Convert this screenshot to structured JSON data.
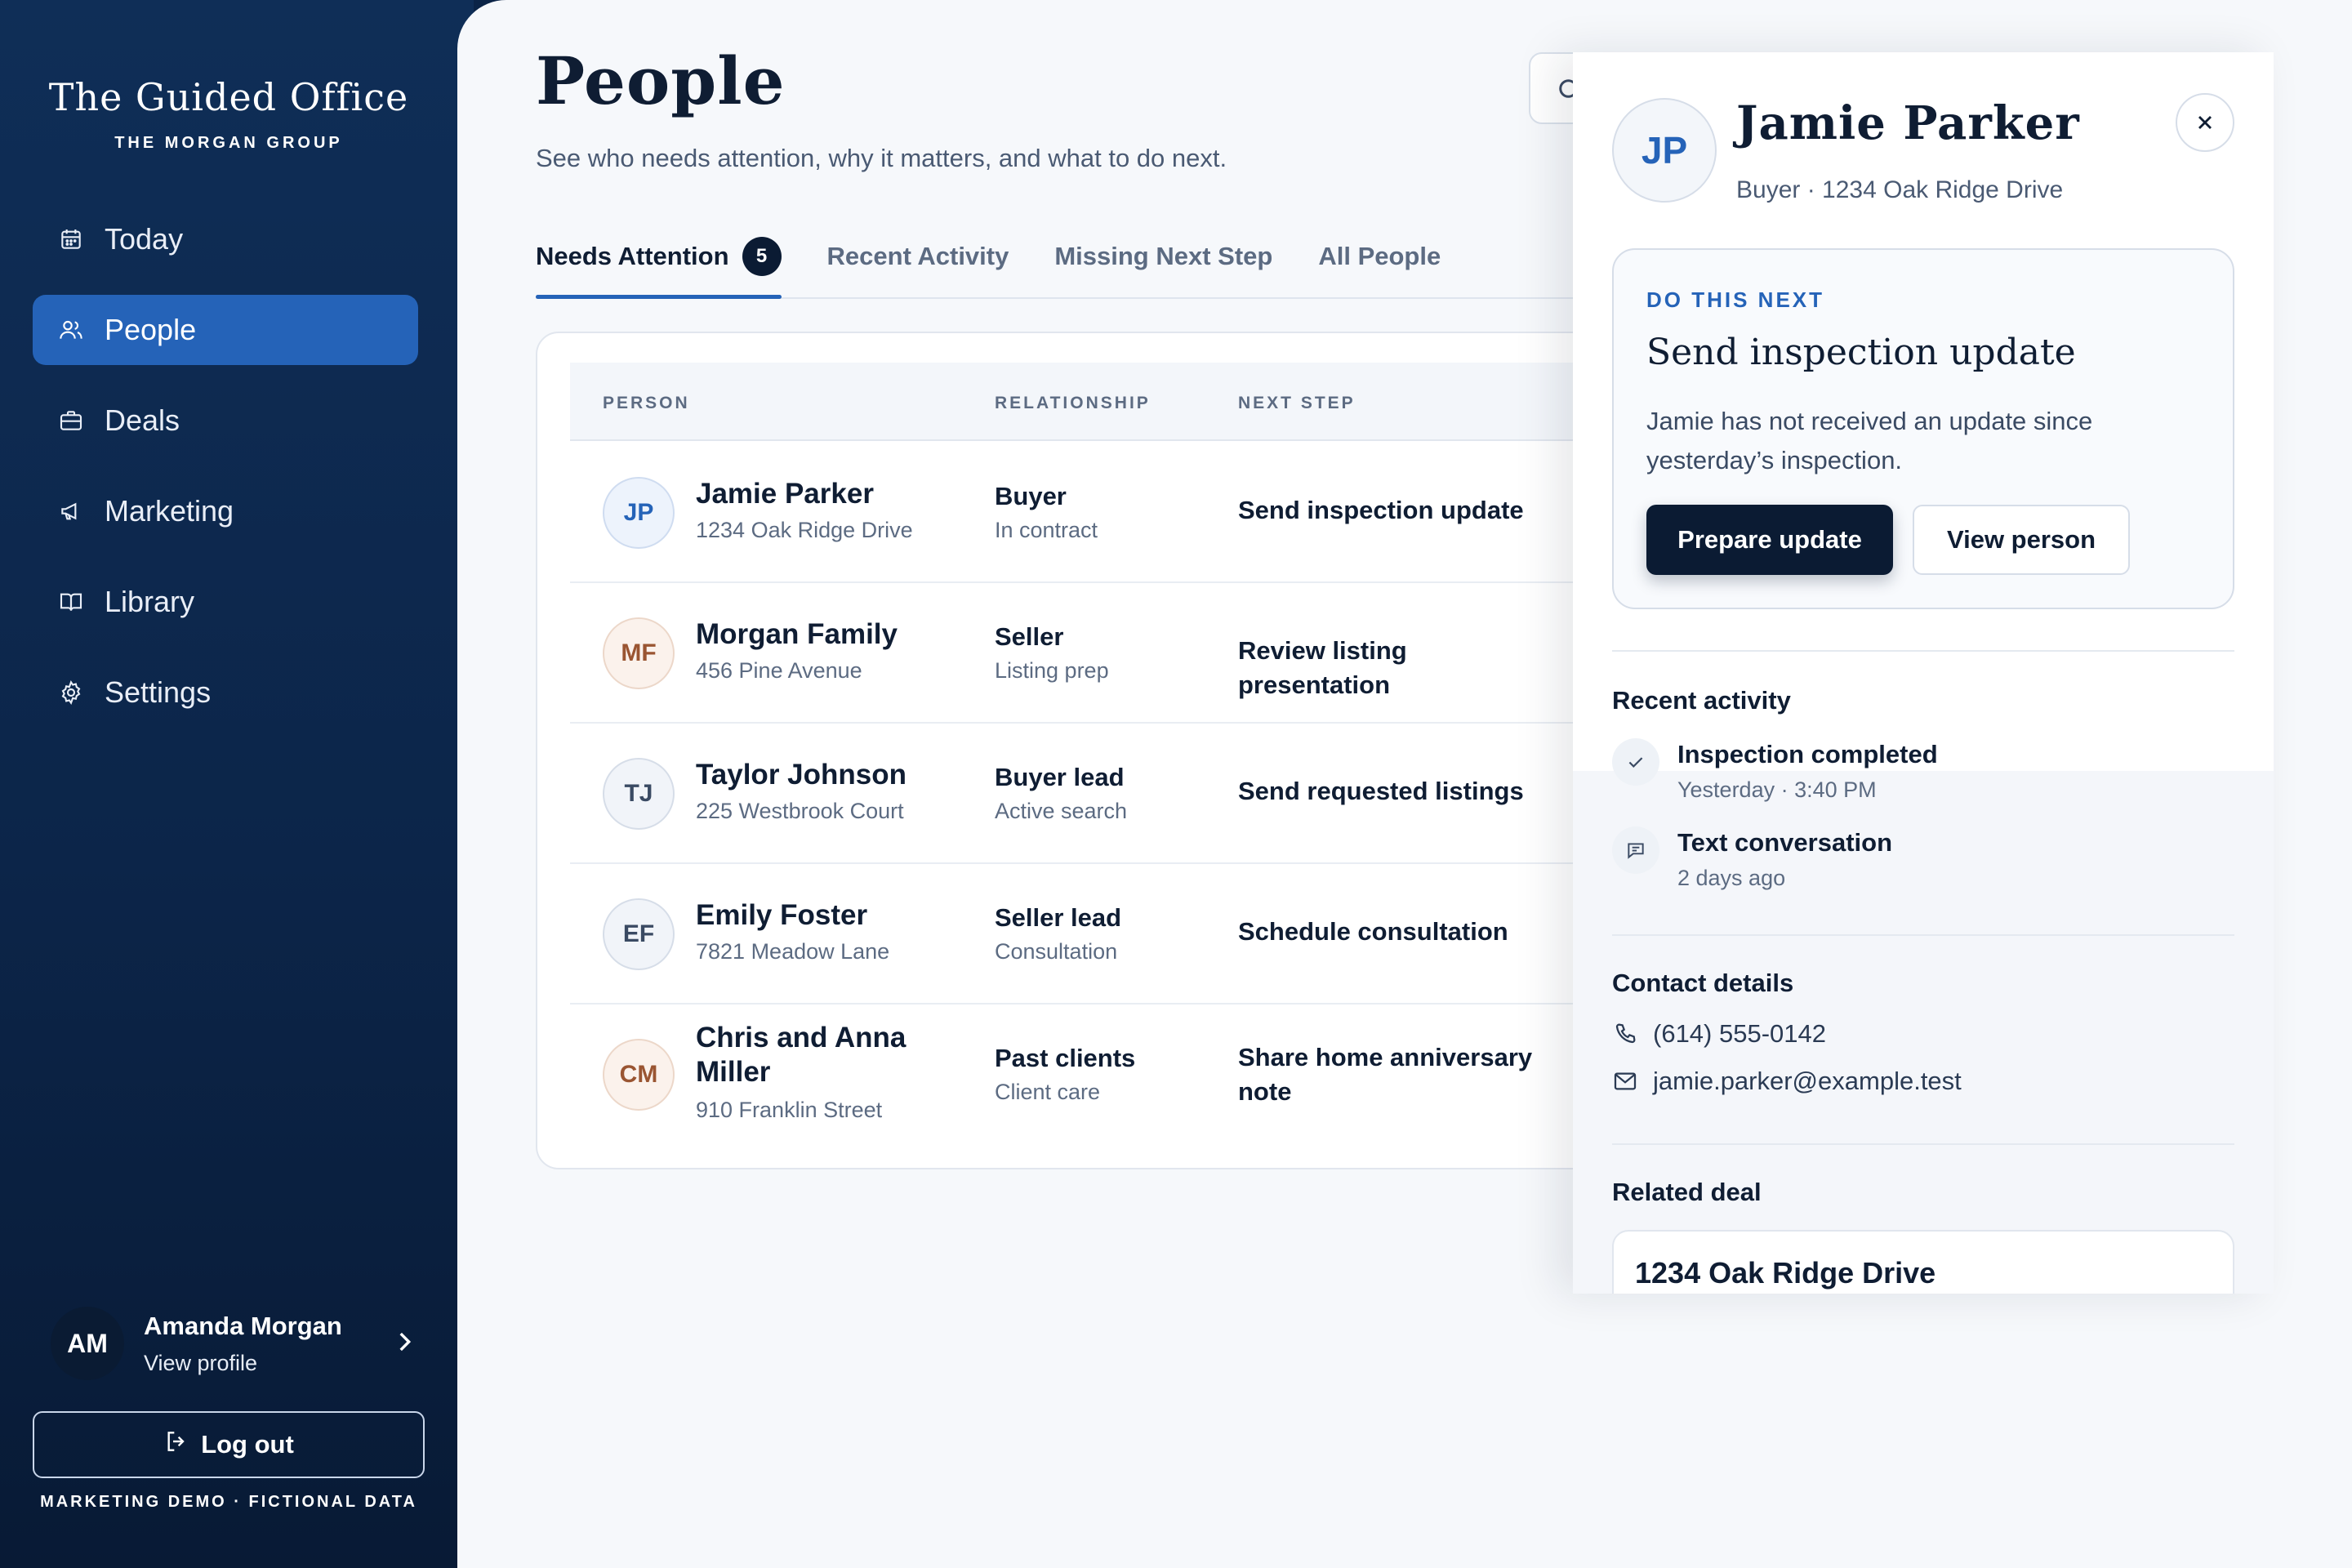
{
  "brand": {
    "title": "The Guided Office",
    "subtitle": "THE MORGAN GROUP"
  },
  "nav": {
    "items": [
      {
        "label": "Today",
        "icon": "calendar-icon"
      },
      {
        "label": "People",
        "icon": "people-icon",
        "active": true
      },
      {
        "label": "Deals",
        "icon": "briefcase-icon"
      },
      {
        "label": "Marketing",
        "icon": "megaphone-icon"
      },
      {
        "label": "Library",
        "icon": "book-icon"
      },
      {
        "label": "Settings",
        "icon": "gear-icon"
      }
    ]
  },
  "profile": {
    "initials": "AM",
    "name": "Amanda Morgan",
    "link": "View profile"
  },
  "logout_label": "Log out",
  "demo_note": "MARKETING DEMO · FICTIONAL DATA",
  "page": {
    "title": "People",
    "subtitle": "See who needs attention, why it matters, and what to do next."
  },
  "tabs": [
    {
      "label": "Needs Attention",
      "badge": "5",
      "active": true
    },
    {
      "label": "Recent Activity"
    },
    {
      "label": "Missing Next Step"
    },
    {
      "label": "All People"
    }
  ],
  "table": {
    "headers": {
      "person": "PERSON",
      "relationship": "RELATIONSHIP",
      "next_step": "NEXT STEP"
    },
    "rows": [
      {
        "initials": "JP",
        "name": "Jamie Parker",
        "address": "1234 Oak Ridge Drive",
        "relationship": "Buyer",
        "status": "In contract",
        "next_step": "Send inspection update"
      },
      {
        "initials": "MF",
        "name": "Morgan Family",
        "address": "456 Pine Avenue",
        "relationship": "Seller",
        "status": "Listing prep",
        "next_step": "Review listing presentation"
      },
      {
        "initials": "TJ",
        "name": "Taylor Johnson",
        "address": "225 Westbrook Court",
        "relationship": "Buyer lead",
        "status": "Active search",
        "next_step": "Send requested listings"
      },
      {
        "initials": "EF",
        "name": "Emily Foster",
        "address": "7821 Meadow Lane",
        "relationship": "Seller lead",
        "status": "Consultation",
        "next_step": "Schedule consultation"
      },
      {
        "initials": "CM",
        "name": "Chris and Anna Miller",
        "address": "910 Franklin Street",
        "relationship": "Past clients",
        "status": "Client care",
        "next_step": "Share home anniversary note"
      }
    ]
  },
  "drawer": {
    "initials": "JP",
    "name": "Jamie Parker",
    "subtitle": "Buyer · 1234 Oak Ridge Drive",
    "next": {
      "kicker": "DO THIS NEXT",
      "title": "Send inspection update",
      "body": "Jamie has not received an update since yesterday’s inspection.",
      "primary_label": "Prepare update",
      "secondary_label": "View person"
    },
    "recent_activity": {
      "heading": "Recent activity",
      "items": [
        {
          "title": "Inspection completed",
          "time": "Yesterday · 3:40 PM",
          "icon": "check-icon"
        },
        {
          "title": "Text conversation",
          "time": "2 days ago",
          "icon": "chat-icon"
        }
      ]
    },
    "contact": {
      "heading": "Contact details",
      "phone": "(614) 555-0142",
      "email": "jamie.parker@example.test"
    },
    "related_deal": {
      "heading": "Related deal",
      "title": "1234 Oak Ridge Drive"
    }
  },
  "colors": {
    "sidebar": "#0c2549",
    "accent": "#2563b8",
    "primary_button": "#0b1b33",
    "background": "#f6f8fb"
  }
}
